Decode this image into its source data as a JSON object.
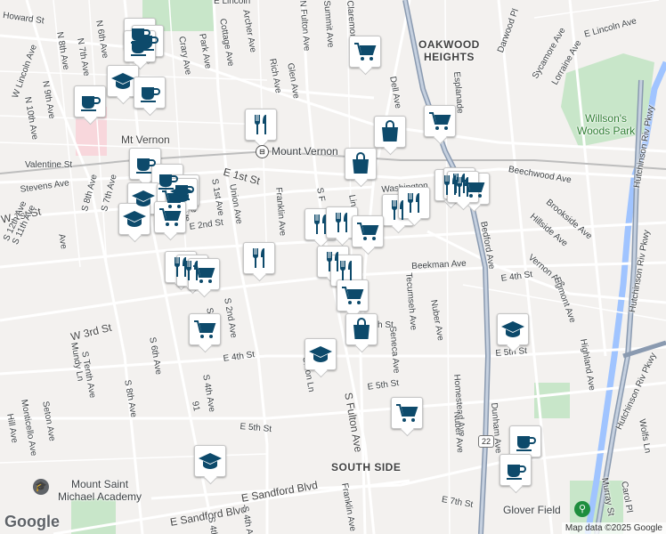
{
  "labels": [
    {
      "id": "howard-st",
      "text": "Howard St"
    },
    {
      "id": "w-lincoln-ave",
      "text": "W Lincoln Ave"
    },
    {
      "id": "n-8th-ave",
      "text": "N 8th Ave"
    },
    {
      "id": "n-7th-ave",
      "text": "N 7th Ave"
    },
    {
      "id": "n-6th-ave",
      "text": "N 6th Ave"
    },
    {
      "id": "n-9th-ave",
      "text": "N 9th Ave"
    },
    {
      "id": "n-10th-ave",
      "text": "N 10th Ave"
    },
    {
      "id": "crary-ave",
      "text": "Crary Ave"
    },
    {
      "id": "park-ave",
      "text": "Park Ave"
    },
    {
      "id": "cottage-ave",
      "text": "Cottage Ave"
    },
    {
      "id": "archer-ave",
      "text": "Archer Ave"
    },
    {
      "id": "rich-ave",
      "text": "Rich Ave"
    },
    {
      "id": "glen-ave",
      "text": "Glen Ave"
    },
    {
      "id": "n-fulton-ave",
      "text": "N Fulton Ave"
    },
    {
      "id": "summit-ave",
      "text": "Summit Ave"
    },
    {
      "id": "claremont",
      "text": "Claremont"
    },
    {
      "id": "dell-ave",
      "text": "Dell Ave"
    },
    {
      "id": "oakwood-heights",
      "text": "OAKWOOD\nHEIGHTS"
    },
    {
      "id": "esplanade",
      "text": "Esplanade"
    },
    {
      "id": "darwood-pl",
      "text": "Darwood Pl"
    },
    {
      "id": "sycamore-ave",
      "text": "Sycamore Ave"
    },
    {
      "id": "lorraine-ave",
      "text": "Lorraine Ave"
    },
    {
      "id": "e-lincoln-ave",
      "text": "E Lincoln Ave"
    },
    {
      "id": "e-lincoln-top",
      "text": "E Lincoln"
    },
    {
      "id": "willsons-woods-park",
      "text": "Willson's\nWoods Park"
    },
    {
      "id": "hutchinson-pkwy-1",
      "text": "Hutchinson Riv Pkwy"
    },
    {
      "id": "hutchinson-pkwy-2",
      "text": "Hutchinson Riv Pkwy"
    },
    {
      "id": "hutchinson-pkwy-3",
      "text": "Hutchinson Riv Pkwy"
    },
    {
      "id": "mt-vernon",
      "text": "Mt Vernon"
    },
    {
      "id": "mount-vernon-station",
      "text": "Mount Vernon"
    },
    {
      "id": "valentine-st",
      "text": "Valentine St"
    },
    {
      "id": "stevens-ave",
      "text": "Stevens Ave"
    },
    {
      "id": "e-1st-st",
      "text": "E 1st St"
    },
    {
      "id": "w-1st-st",
      "text": "W 1st St"
    },
    {
      "id": "washington",
      "text": "Washington"
    },
    {
      "id": "beechwood-ave",
      "text": "Beechwood Ave"
    },
    {
      "id": "brookside-ave",
      "text": "Brookside Ave"
    },
    {
      "id": "hillside-ave",
      "text": "Hillside Ave"
    },
    {
      "id": "bedford-ave",
      "text": "Bedford Ave"
    },
    {
      "id": "vernon-ave",
      "text": "Vernon Ave"
    },
    {
      "id": "egmont-ave",
      "text": "Egmont Ave"
    },
    {
      "id": "s-11th-ave",
      "text": "S 11th Ave"
    },
    {
      "id": "s-12th-ave",
      "text": "S 12th Ave"
    },
    {
      "id": "s-8th-ave",
      "text": "S 8th Ave"
    },
    {
      "id": "s-7th-ave",
      "text": "S 7th Ave"
    },
    {
      "id": "s-1st-ave",
      "text": "S 1st Ave"
    },
    {
      "id": "union-ave",
      "text": "Union Ave"
    },
    {
      "id": "franklin-ave",
      "text": "Franklin Ave"
    },
    {
      "id": "e-2nd-st",
      "text": "E 2nd St"
    },
    {
      "id": "beekman-ave",
      "text": "Beekman Ave"
    },
    {
      "id": "e-4th-st-right",
      "text": "E 4th St"
    },
    {
      "id": "w-3rd-st",
      "text": "W 3rd St"
    },
    {
      "id": "s-2nd-ave",
      "text": "S 2nd Ave"
    },
    {
      "id": "s-6th-ave",
      "text": "S 6th Ave"
    },
    {
      "id": "tecumseh-ave",
      "text": "Tecumseh Ave"
    },
    {
      "id": "nuber-ave",
      "text": "Nuber Ave"
    },
    {
      "id": "seneca-ave",
      "text": "Seneca Ave"
    },
    {
      "id": "e-5th-st-right",
      "text": "E 5th St"
    },
    {
      "id": "e-4th-st",
      "text": "E 4th St"
    },
    {
      "id": "union-ln",
      "text": "Union Ln"
    },
    {
      "id": "s-fulton-ave",
      "text": "S Fulton Ave"
    },
    {
      "id": "e-5th-st",
      "text": "E 5th St"
    },
    {
      "id": "homestead-ave",
      "text": "Homestead Ave"
    },
    {
      "id": "nuber-ave-2",
      "text": "Nuber Ave"
    },
    {
      "id": "dunham-ave",
      "text": "Dunham Ave"
    },
    {
      "id": "highland-ave",
      "text": "Highland Ave"
    },
    {
      "id": "mundy-ln",
      "text": "Mundy Ln"
    },
    {
      "id": "s-tenth-ave",
      "text": "S Tenth Ave"
    },
    {
      "id": "s-8th-ave-2",
      "text": "S 8th Ave"
    },
    {
      "id": "s-4th-ave",
      "text": "S 4th Ave"
    },
    {
      "id": "s-3rd-ave",
      "text": "S 3rd Ave"
    },
    {
      "id": "e-5th-st-2",
      "text": "E 5th St"
    },
    {
      "id": "seton-ave",
      "text": "Seton Ave"
    },
    {
      "id": "monticello-ave",
      "text": "Monticello Ave"
    },
    {
      "id": "hill-ave",
      "text": "Hill Ave"
    },
    {
      "id": "south-side",
      "text": "SOUTH SIDE"
    },
    {
      "id": "mount-saint-michael",
      "text": "Mount Saint\nMichael Academy"
    },
    {
      "id": "e-sandford-blvd",
      "text": "E Sandford Blvd"
    },
    {
      "id": "e-sandford-blvd-2",
      "text": "E Sandford Blvd"
    },
    {
      "id": "franklin-ave-2",
      "text": "Franklin Ave"
    },
    {
      "id": "e-7th-st",
      "text": "E 7th St"
    },
    {
      "id": "glover-field",
      "text": "Glover Field"
    },
    {
      "id": "wolfs-ln",
      "text": "Wolfs Ln"
    },
    {
      "id": "murray-st",
      "text": "Murray St"
    },
    {
      "id": "carol-pl",
      "text": "Carol Pl"
    },
    {
      "id": "s-ave",
      "text": "S 4th Ave"
    },
    {
      "id": "s-fulton-upper",
      "text": "S F"
    },
    {
      "id": "s-ln",
      "text": "Lin"
    },
    {
      "id": "s-5th-ave",
      "text": "S 5th Ave"
    },
    {
      "id": "s-6th-ave-top",
      "text": "S 6th Ave"
    },
    {
      "id": "ve-label",
      "text": "Ave"
    },
    {
      "id": "h-st",
      "text": "h St"
    },
    {
      "id": "route-91",
      "text": "91"
    },
    {
      "id": "e-4th-ave",
      "text": "E 4th Ave"
    },
    {
      "id": "s-sandford",
      "text": "S 4th"
    }
  ],
  "shields": [
    {
      "id": "route-22",
      "text": "22"
    }
  ],
  "pins": [
    {
      "id": "pin-1",
      "type": "coffee"
    },
    {
      "id": "pin-2",
      "type": "coffee"
    },
    {
      "id": "pin-3",
      "type": "coffee"
    },
    {
      "id": "pin-4",
      "type": "school"
    },
    {
      "id": "pin-5",
      "type": "coffee"
    },
    {
      "id": "pin-6",
      "type": "coffee"
    },
    {
      "id": "pin-7",
      "type": "coffee"
    },
    {
      "id": "pin-8",
      "type": "shopping-cart"
    },
    {
      "id": "pin-9",
      "type": "restaurant"
    },
    {
      "id": "pin-10",
      "type": "shopping-bag"
    },
    {
      "id": "pin-11",
      "type": "shopping-cart"
    },
    {
      "id": "pin-12",
      "type": "shopping-bag"
    },
    {
      "id": "pin-13",
      "type": "coffee"
    },
    {
      "id": "pin-14",
      "type": "coffee"
    },
    {
      "id": "pin-15",
      "type": "school"
    },
    {
      "id": "pin-16",
      "type": "shopping-cart"
    },
    {
      "id": "pin-17",
      "type": "school"
    },
    {
      "id": "pin-18",
      "type": "shopping-cart"
    },
    {
      "id": "pin-19",
      "type": "school"
    },
    {
      "id": "pin-20",
      "type": "restaurant"
    },
    {
      "id": "pin-21",
      "type": "restaurant"
    },
    {
      "id": "pin-22",
      "type": "restaurant"
    },
    {
      "id": "pin-23",
      "type": "shopping-cart"
    },
    {
      "id": "pin-24",
      "type": "restaurant"
    },
    {
      "id": "pin-25",
      "type": "restaurant"
    },
    {
      "id": "pin-26",
      "type": "restaurant"
    },
    {
      "id": "pin-27",
      "type": "shopping-cart"
    },
    {
      "id": "pin-28",
      "type": "restaurant"
    },
    {
      "id": "pin-29",
      "type": "restaurant"
    },
    {
      "id": "pin-30",
      "type": "restaurant"
    },
    {
      "id": "pin-31",
      "type": "restaurant"
    },
    {
      "id": "pin-32",
      "type": "restaurant"
    },
    {
      "id": "pin-33",
      "type": "shopping-cart"
    },
    {
      "id": "pin-34",
      "type": "shopping-cart"
    },
    {
      "id": "pin-35",
      "type": "shopping-bag"
    },
    {
      "id": "pin-36",
      "type": "school"
    },
    {
      "id": "pin-37",
      "type": "shopping-cart"
    },
    {
      "id": "pin-38",
      "type": "school"
    },
    {
      "id": "pin-39",
      "type": "school"
    },
    {
      "id": "pin-40",
      "type": "coffee"
    },
    {
      "id": "pin-41",
      "type": "coffee"
    },
    {
      "id": "pin-42",
      "type": "shopping-cart"
    },
    {
      "id": "pin-43",
      "type": "restaurant"
    }
  ],
  "attribution": "Map data ©2025 Google",
  "logo": "Google",
  "colors": {
    "pin_icon": "#0d4a6b",
    "park": "#c8e6c9",
    "water": "#a0c4ff",
    "road": "#ffffff",
    "highway": "#8a9ab0",
    "background": "#f3f1ef"
  }
}
